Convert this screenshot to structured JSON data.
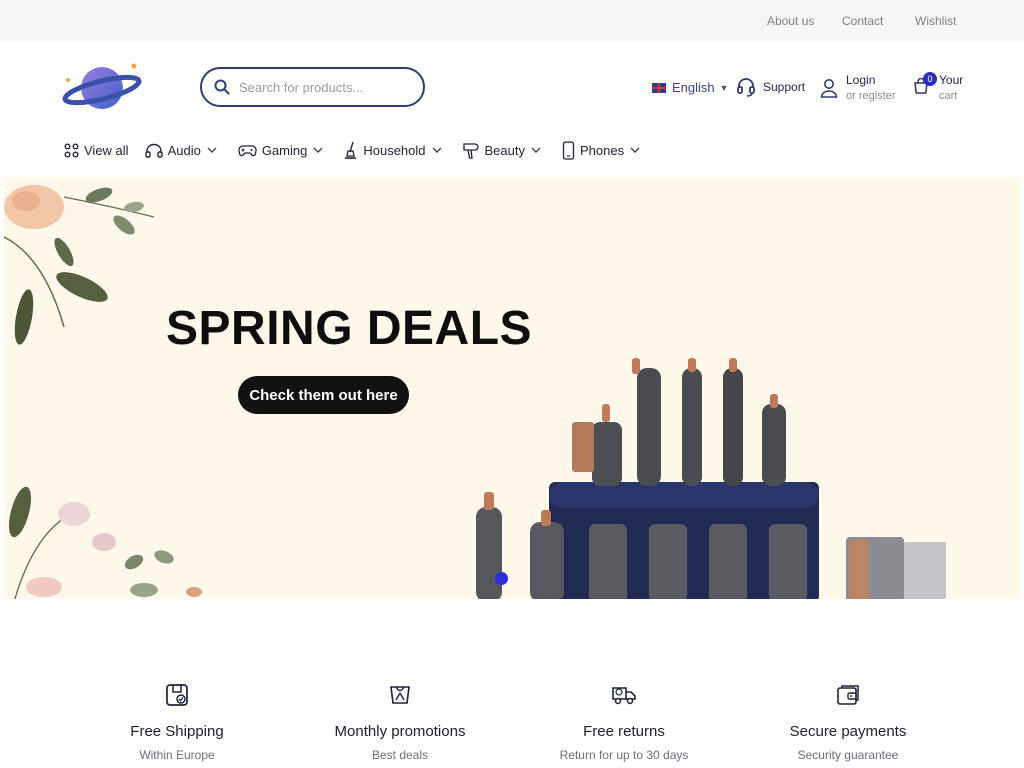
{
  "topbar": {
    "about": "About us",
    "contact": "Contact",
    "wishlist": "Wishlist"
  },
  "header": {
    "search_placeholder": "Search for products...",
    "language": "English",
    "support": "Support",
    "login": "Login",
    "register": "or register",
    "cart_count": "0",
    "cart_line1": "Your",
    "cart_line2": "cart"
  },
  "nav": {
    "items": [
      {
        "label": "View all",
        "icon": "grid-icon"
      },
      {
        "label": "Audio",
        "icon": "headphones-icon"
      },
      {
        "label": "Gaming",
        "icon": "gamepad-icon"
      },
      {
        "label": "Household",
        "icon": "vacuum-icon"
      },
      {
        "label": "Beauty",
        "icon": "hairdryer-icon"
      },
      {
        "label": "Phones",
        "icon": "phone-icon"
      }
    ]
  },
  "hero": {
    "title": "SPRING DEALS",
    "button": "Check them out here"
  },
  "features": [
    {
      "title": "Free Shipping",
      "subtitle": "Within Europe",
      "icon": "package-icon"
    },
    {
      "title": "Monthly promotions",
      "subtitle": "Best deals",
      "icon": "gift-icon"
    },
    {
      "title": "Free returns",
      "subtitle": "Return for up to 30 days",
      "icon": "truck-icon"
    },
    {
      "title": "Secure payments",
      "subtitle": "Security guarantee",
      "icon": "wallet-icon"
    }
  ],
  "colors": {
    "brand": "#2f3d73",
    "accent": "#2e2fd6",
    "hero_bg": "#fdf8ea",
    "topbar_bg": "#f6f6f7"
  }
}
